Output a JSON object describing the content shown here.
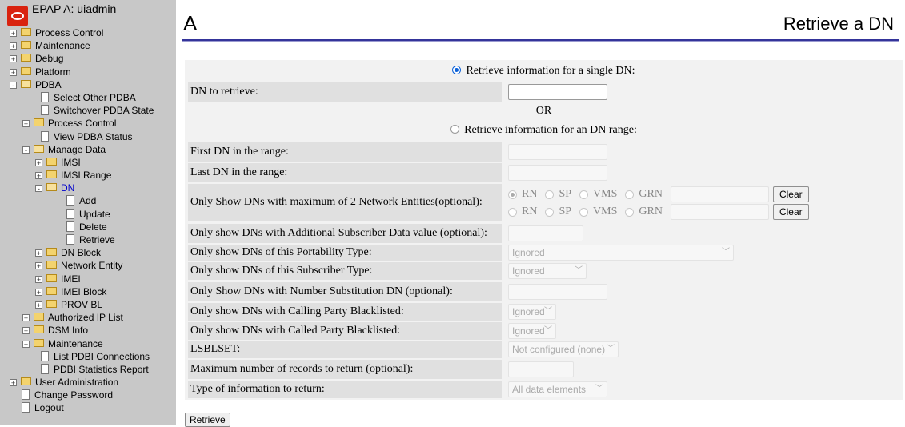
{
  "header": {
    "title": "EPAP A: uiadmin"
  },
  "tree": [
    {
      "label": "Process Control",
      "type": "folder",
      "level": 0,
      "expander": "+"
    },
    {
      "label": "Maintenance",
      "type": "folder",
      "level": 0,
      "expander": "+"
    },
    {
      "label": "Debug",
      "type": "folder",
      "level": 0,
      "expander": "+"
    },
    {
      "label": "Platform",
      "type": "folder",
      "level": 0,
      "expander": "+"
    },
    {
      "label": "PDBA",
      "type": "folder-open",
      "level": 0,
      "expander": "-"
    },
    {
      "label": "Select Other PDBA",
      "type": "page",
      "level": 1
    },
    {
      "label": "Switchover PDBA State",
      "type": "page",
      "level": 1
    },
    {
      "label": "Process Control",
      "type": "folder",
      "level": 1,
      "expander": "+"
    },
    {
      "label": "View PDBA Status",
      "type": "page",
      "level": 1
    },
    {
      "label": "Manage Data",
      "type": "folder-open",
      "level": 1,
      "expander": "-"
    },
    {
      "label": "IMSI",
      "type": "folder",
      "level": 2,
      "expander": "+"
    },
    {
      "label": "IMSI Range",
      "type": "folder",
      "level": 2,
      "expander": "+"
    },
    {
      "label": "DN",
      "type": "folder-open",
      "level": 2,
      "expander": "-",
      "active": true
    },
    {
      "label": "Add",
      "type": "page",
      "level": 3
    },
    {
      "label": "Update",
      "type": "page",
      "level": 3
    },
    {
      "label": "Delete",
      "type": "page",
      "level": 3
    },
    {
      "label": "Retrieve",
      "type": "page",
      "level": 3
    },
    {
      "label": "DN Block",
      "type": "folder",
      "level": 2,
      "expander": "+"
    },
    {
      "label": "Network Entity",
      "type": "folder",
      "level": 2,
      "expander": "+"
    },
    {
      "label": "IMEI",
      "type": "folder",
      "level": 2,
      "expander": "+"
    },
    {
      "label": "IMEI Block",
      "type": "folder",
      "level": 2,
      "expander": "+"
    },
    {
      "label": "PROV BL",
      "type": "folder",
      "level": 2,
      "expander": "+"
    },
    {
      "label": "Authorized IP List",
      "type": "folder",
      "level": 1,
      "expander": "+"
    },
    {
      "label": "DSM Info",
      "type": "folder",
      "level": 1,
      "expander": "+"
    },
    {
      "label": "Maintenance",
      "type": "folder",
      "level": 1,
      "expander": "+"
    },
    {
      "label": "List PDBI Connections",
      "type": "page",
      "level": 1
    },
    {
      "label": "PDBI Statistics Report",
      "type": "page",
      "level": 1
    },
    {
      "label": "User Administration",
      "type": "folder",
      "level": 0,
      "expander": "+"
    },
    {
      "label": "Change Password",
      "type": "page",
      "level": 0
    },
    {
      "label": "Logout",
      "type": "page",
      "level": 0
    }
  ],
  "page": {
    "letter": "A",
    "title": "Retrieve a DN"
  },
  "form": {
    "single_radio_label": "Retrieve information for a single DN:",
    "dn_label": "DN to retrieve:",
    "or_text": "OR",
    "range_radio_label": "Retrieve information for an DN range:",
    "first_dn_label": "First DN in the range:",
    "last_dn_label": "Last DN in the range:",
    "ne_label": "Only Show DNs with maximum of 2 Network Entities(optional):",
    "ne_options": [
      "RN",
      "SP",
      "VMS",
      "GRN"
    ],
    "clear_label": "Clear",
    "asd_label": "Only show DNs with Additional Subscriber Data value (optional):",
    "portability_label": "Only show DNs of this Portability Type:",
    "portability_value": "Ignored",
    "subscriber_label": "Only show DNs of this Subscriber Type:",
    "subscriber_value": "Ignored",
    "nsdn_label": "Only Show DNs with Number Substitution DN (optional):",
    "calling_label": "Only show DNs with Calling Party Blacklisted:",
    "calling_value": "Ignored",
    "called_label": "Only show DNs with Called Party Blacklisted:",
    "called_value": "Ignored",
    "lsblset_label": "LSBLSET:",
    "lsblset_value": "Not configured (none)",
    "max_label": "Maximum number of records to return (optional):",
    "type_label": "Type of information to return:",
    "type_value": "All data elements",
    "retrieve_label": "Retrieve"
  }
}
